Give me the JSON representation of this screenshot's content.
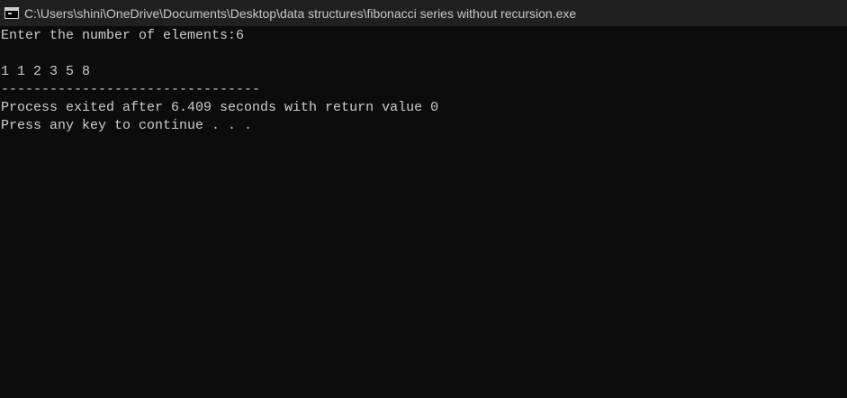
{
  "window": {
    "title": "C:\\Users\\shini\\OneDrive\\Documents\\Desktop\\data structures\\fibonacci series without recursion.exe",
    "icon": "console-icon"
  },
  "console": {
    "lines": [
      "Enter the number of elements:6",
      "",
      "1 1 2 3 5 8",
      "--------------------------------",
      "Process exited after 6.409 seconds with return value 0",
      "Press any key to continue . . ."
    ]
  },
  "colors": {
    "background": "#0c0c0c",
    "titlebar": "#202020",
    "text": "#cccccc"
  }
}
